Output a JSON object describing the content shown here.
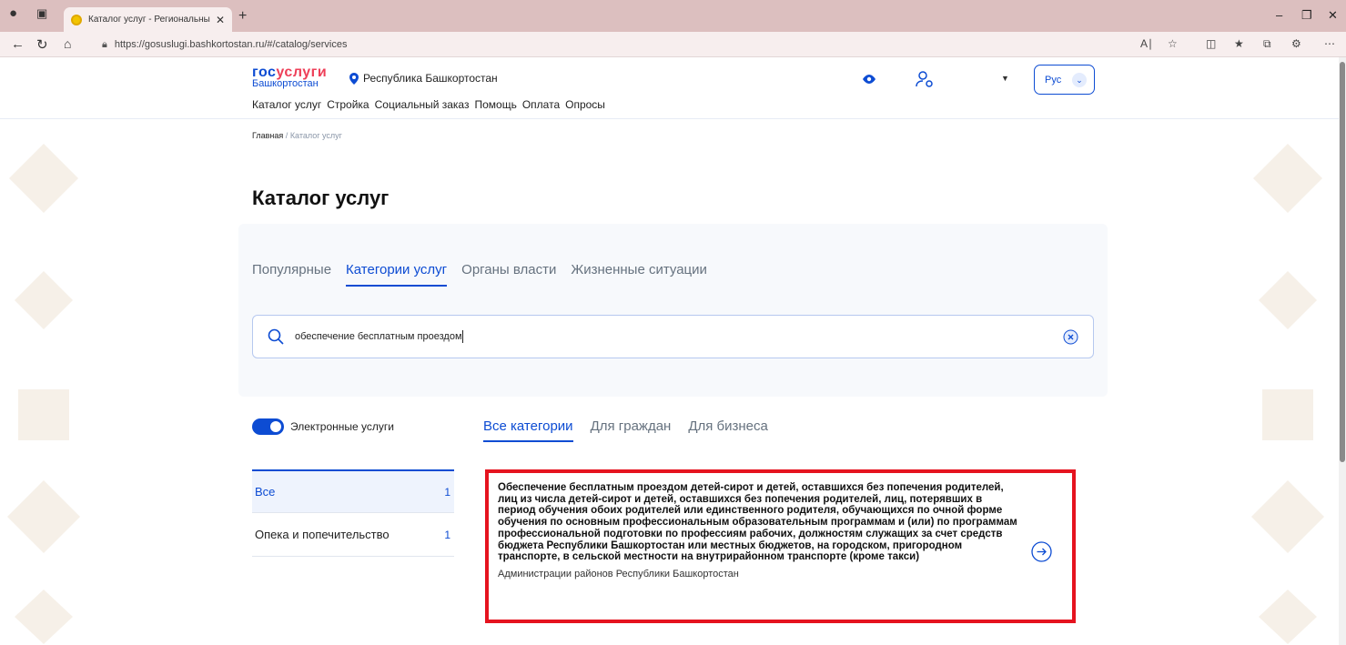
{
  "browser": {
    "tab_title": "Каталог услуг - Региональный п",
    "url": "https://gosuslugi.bashkortostan.ru/#/catalog/services"
  },
  "header": {
    "logo_main_part1": "гос",
    "logo_main_part2": "услуги",
    "logo_region": "Башкортостан",
    "region": "Республика Башкортостан",
    "lang": "Рус"
  },
  "menu": [
    "Каталог услуг",
    "Стройка",
    "Социальный заказ",
    "Помощь",
    "Оплата",
    "Опросы"
  ],
  "breadcrumb": {
    "home": "Главная",
    "separator": "/",
    "current": "Каталог услуг"
  },
  "page_title": "Каталог услуг",
  "tabs": [
    "Популярные",
    "Категории услуг",
    "Органы власти",
    "Жизненные ситуации"
  ],
  "search": {
    "value": "обеспечение бесплатным проездом"
  },
  "toggle_label": "Электронные услуги",
  "category_tabs": [
    "Все категории",
    "Для граждан",
    "Для бизнеса"
  ],
  "side_list": [
    {
      "label": "Все",
      "count": "1"
    },
    {
      "label": "Опека и попечительство",
      "count": "1"
    }
  ],
  "result": {
    "title": "Обеспечение бесплатным проездом детей-сирот и детей, оставшихся без попечения родителей, лиц из числа детей-сирот и детей, оставшихся без попечения родителей, лиц, потерявших в период обучения обоих родителей или единственного родителя, обучающихся по очной форме обучения по основным профессиональным образовательным программам и (или) по программам профессиональной подготовки по профессиям рабочих, должностям служащих за счет средств бюджета Республики Башкортостан или местных бюджетов, на городском, пригородном транспорте, в сельской местности на внутрирайонном транспорте (кроме такси)",
    "org": "Администрации районов Республики Башкортостан"
  },
  "colors": {
    "accent": "#0d4cd3",
    "highlight": "#e5131f",
    "brand_red": "#ee3f58"
  }
}
